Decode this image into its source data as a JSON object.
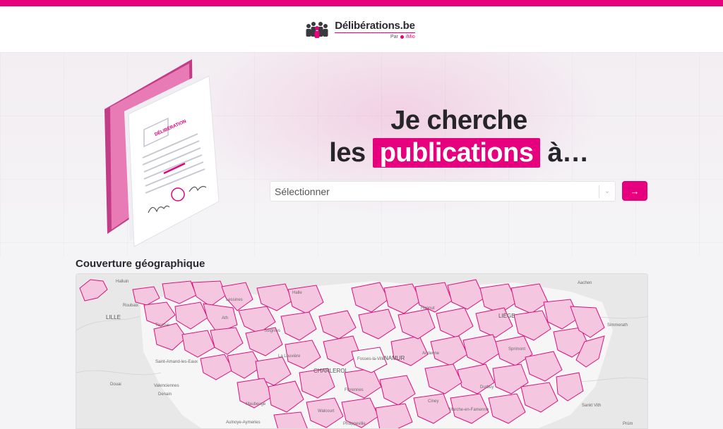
{
  "header": {
    "brand_name": "Délibérations.be",
    "sub_prefix": "Par",
    "sub_brand": "iMio"
  },
  "hero": {
    "illustration_stamp": "DÉLIBÉRATION",
    "line1": "Je cherche",
    "line2_prefix": "les",
    "line2_highlight": "publications",
    "line2_suffix": "à…",
    "select_placeholder": "Sélectionner",
    "submit_icon": "arrow-right-icon"
  },
  "coverage": {
    "title": "Couverture géographique"
  },
  "map": {
    "labels": {
      "halluin": "Halluin",
      "roubaix": "Roubaix",
      "lille": "LILLE",
      "tournai": "Tournai",
      "saint_amand": "Saint-Amand-les-Eaux",
      "douai": "Douai",
      "valenciennes": "Valenciennes",
      "denain": "Denain",
      "maubeuge": "Maubeuge",
      "aulnoye": "Aulnoye-Aymeries",
      "lessines": "Lessines",
      "ath": "Ath",
      "soignies": "Soignies",
      "la_louviere": "La Louvière",
      "charleroi": "CHARLEROI",
      "namur": "NAMUR",
      "halle": "Halle",
      "hannut": "Hannut",
      "liege": "LIÈGE",
      "andenne": "Andenne",
      "sprimont": "Sprimont",
      "durbuy": "Durbuy",
      "ciney": "Ciney",
      "marche": "Marche-en-Famenne",
      "aachen": "Aachen",
      "simmerath": "Simmerath",
      "saint_vith": "Sankt Vith",
      "prum": "Prüm",
      "walcourt": "Walcourt",
      "philippeville": "Philippeville",
      "florennes": "Florennes",
      "fosses": "Fosses-la-Ville"
    }
  },
  "colors": {
    "brand_pink": "#e6007e",
    "dark_text": "#26262a",
    "commune_fill": "#f5c6e0",
    "commune_border": "#d8127f"
  }
}
